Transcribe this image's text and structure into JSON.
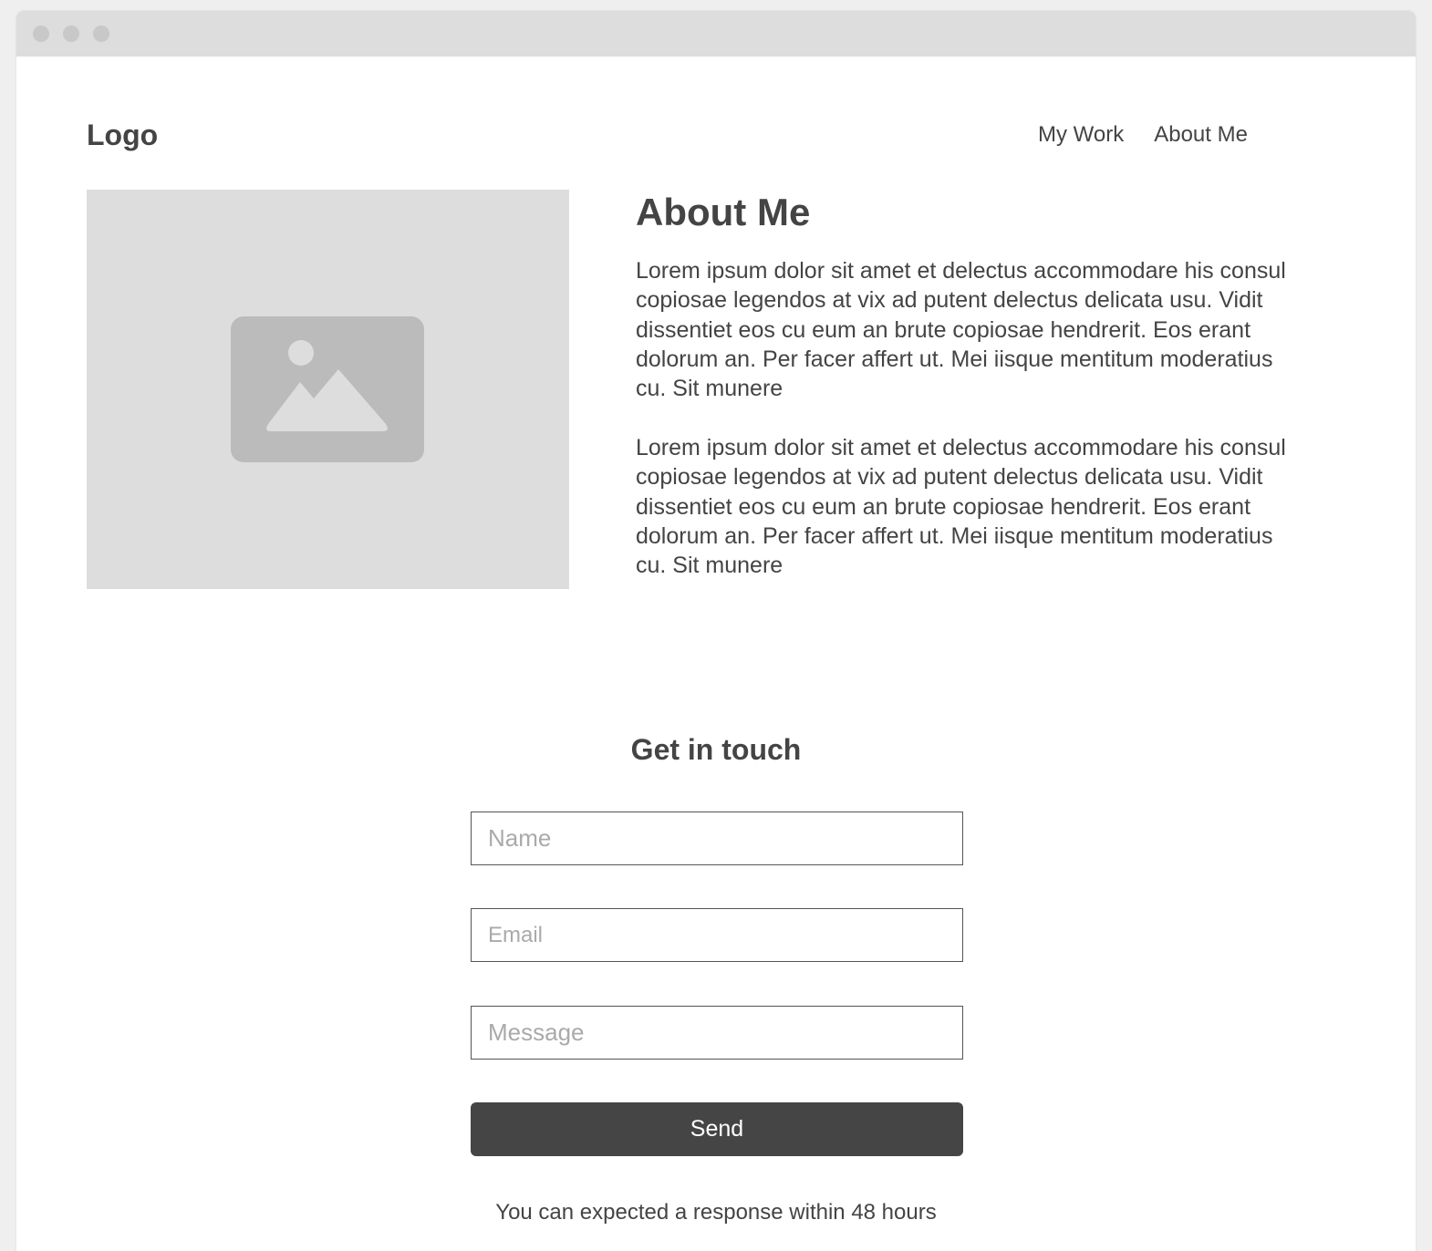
{
  "window": {
    "controls": [
      "close",
      "minimize",
      "maximize"
    ]
  },
  "header": {
    "logo": "Logo",
    "nav": [
      {
        "label": "My Work"
      },
      {
        "label": "About Me"
      }
    ]
  },
  "about": {
    "image_icon": "image-placeholder-icon",
    "heading": "About Me",
    "paragraphs": [
      "Lorem ipsum dolor sit amet et delectus accommodare his consul copiosae legendos at vix ad putent delectus delicata usu. Vidit dissentiet eos cu eum an brute copiosae hendrerit. Eos erant dolorum an. Per facer affert ut. Mei iisque mentitum moderatius cu. Sit munere",
      "Lorem ipsum dolor sit amet et delectus accommodare his consul copiosae legendos at vix ad putent delectus delicata usu. Vidit dissentiet eos cu eum an brute copiosae hendrerit. Eos erant dolorum an. Per facer affert ut. Mei iisque mentitum moderatius cu. Sit munere"
    ]
  },
  "contact": {
    "heading": "Get in touch",
    "fields": {
      "name": {
        "value": "",
        "placeholder": "Name"
      },
      "email": {
        "value": "",
        "placeholder": "Email"
      },
      "message": {
        "value": "",
        "placeholder": "Message"
      }
    },
    "send_label": "Send",
    "note": "You can expected a response within 48 hours"
  },
  "colors": {
    "page_background": "#efefef",
    "titlebar": "#dddddd",
    "text": "#444444",
    "placeholder_block": "#dddddd",
    "placeholder_icon": "#bbbbbb",
    "button": "#454545",
    "button_text": "#ffffff"
  }
}
